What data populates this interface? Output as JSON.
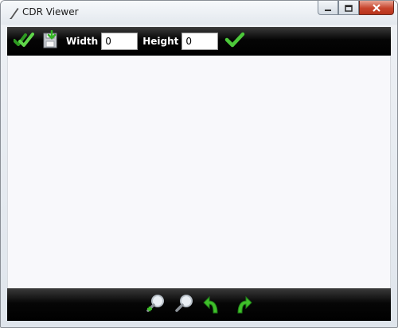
{
  "window": {
    "title": "CDR Viewer",
    "icons": {
      "app": "pen-icon",
      "minimize": "minimize-icon",
      "maximize": "maximize-icon",
      "close": "close-icon"
    }
  },
  "toolbar": {
    "width_label": "Width",
    "width_value": "0",
    "height_label": "Height",
    "height_value": "0",
    "icons": {
      "open": "double-check-icon",
      "save": "save-disk-icon",
      "apply": "check-icon"
    }
  },
  "bottombar": {
    "icons": [
      "zoom-in-icon",
      "zoom-out-icon",
      "rotate-left-icon",
      "rotate-right-icon"
    ]
  },
  "colors": {
    "toolbar_bg": "#000000",
    "accent_green": "#3fbf2a",
    "close_red": "#c7442c"
  }
}
